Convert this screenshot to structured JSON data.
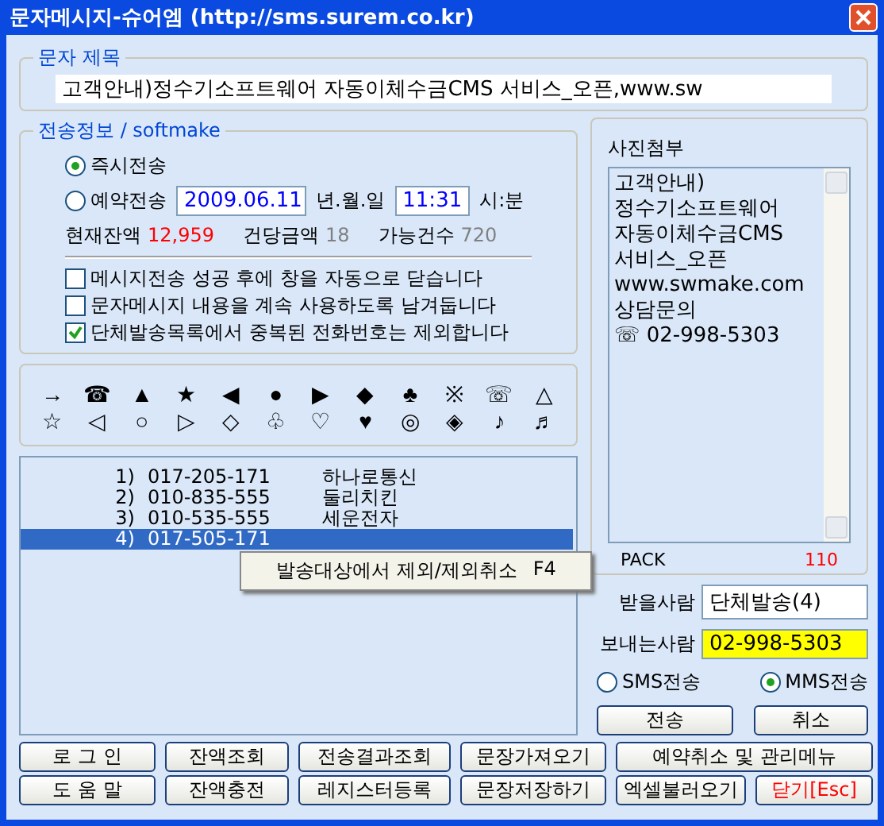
{
  "window": {
    "title": "문자메시지-슈어엠 (http://sms.surem.co.kr)"
  },
  "subject": {
    "legend": "문자 제목",
    "value": "고객안내)정수기소프트웨어 자동이체수금CMS 서비스_오픈,www.sw"
  },
  "send_info": {
    "legend": "전송정보 / softmake",
    "modes": [
      {
        "label": "즉시전송",
        "selected": true
      },
      {
        "label": "예약전송",
        "selected": false
      }
    ],
    "date": "2009.06.11",
    "date_unit": "년.월.일",
    "time": "11:31",
    "time_unit": "시:분",
    "stats": [
      {
        "label": "현재잔액",
        "value": "12,959",
        "color": "#ff0000"
      },
      {
        "label": "건당금액",
        "value": "18",
        "color": "#808080"
      },
      {
        "label": "가능건수",
        "value": "720",
        "color": "#808080"
      }
    ],
    "options": [
      {
        "label": "메시지전송 성공 후에 창을 자동으로 닫습니다",
        "checked": false
      },
      {
        "label": "문자메시지 내용을 계속 사용하도록 남겨둡니다",
        "checked": false
      },
      {
        "label": "단체발송목록에서 중복된 전화번호는 제외합니다",
        "checked": true
      }
    ]
  },
  "symbols": [
    [
      "→",
      "☎",
      "▲",
      "★",
      "◀",
      "●",
      "▶",
      "◆",
      "♣",
      "※",
      "☏",
      "△"
    ],
    [
      "☆",
      "◁",
      "○",
      "▷",
      "◇",
      "♧",
      "♡",
      "♥",
      "◎",
      "◈",
      "♪",
      "♬"
    ]
  ],
  "recipients": [
    {
      "index": "1)",
      "number": "017-205-171",
      "name": "하나로통신",
      "selected": false
    },
    {
      "index": "2)",
      "number": "010-835-555",
      "name": "둘리치킨",
      "selected": false
    },
    {
      "index": "3)",
      "number": "010-535-555",
      "name": "세운전자",
      "selected": false
    },
    {
      "index": "4)",
      "number": "017-505-171",
      "selected": true
    }
  ],
  "context_menu": {
    "label": "발송대상에서 제외/제외취소",
    "shortcut": "F4"
  },
  "photo": {
    "title": "사진첨부",
    "lines": [
      "고객안내)",
      "정수기소프트웨어",
      "자동이체수금CMS",
      "서비스_오픈",
      "www.swmake.com",
      "상담문의",
      "☏ 02-998-5303"
    ],
    "pack_label": "PACK",
    "pack_value": "110"
  },
  "to": {
    "label": "받을사람",
    "value": "단체발송(4)"
  },
  "from": {
    "label": "보내는사람",
    "value": "02-998-5303"
  },
  "send_types": [
    {
      "label": "SMS전송",
      "selected": false
    },
    {
      "label": "MMS전송",
      "selected": true
    }
  ],
  "actions": [
    "전송",
    "취소"
  ],
  "bottom_buttons": [
    [
      {
        "label": "로 그 인"
      },
      {
        "label": "잔액조회"
      },
      {
        "label": "전송결과조회"
      },
      {
        "label": "문장가져오기"
      },
      {
        "label": "예약취소 및 관리메뉴"
      }
    ],
    [
      {
        "label": "도 움 말"
      },
      {
        "label": "잔액충전"
      },
      {
        "label": "레지스터등록"
      },
      {
        "label": "문장저장하기"
      },
      {
        "label": "엑셀불러오기"
      },
      {
        "label": "닫기[Esc]",
        "kind": "danger"
      }
    ]
  ]
}
